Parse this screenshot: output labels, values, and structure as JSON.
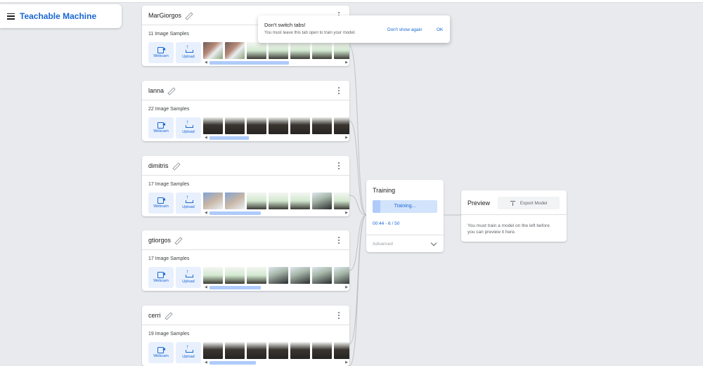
{
  "app": {
    "title": "Teachable Machine"
  },
  "classes": [
    {
      "name": "MarGiorgos",
      "samples": "11 Image Samples",
      "webcam_label": "Webcam",
      "upload_label": "Upload"
    },
    {
      "name": "lanna",
      "samples": "22 Image Samples",
      "webcam_label": "Webcam",
      "upload_label": "Upload"
    },
    {
      "name": "dimitris",
      "samples": "17 Image Samples",
      "webcam_label": "Webcam",
      "upload_label": "Upload"
    },
    {
      "name": "gtiorgos",
      "samples": "17 Image Samples",
      "webcam_label": "Webcam",
      "upload_label": "Upload"
    },
    {
      "name": "cerri",
      "samples": "19 Image Samples",
      "webcam_label": "Webcam",
      "upload_label": "Upload"
    }
  ],
  "training": {
    "title": "Training",
    "button_label": "Training...",
    "progress_fraction": 0.12,
    "time_text": "00:44 - 6 / 50",
    "advanced_label": "Advanced"
  },
  "preview": {
    "title": "Preview",
    "export_label": "Export Model",
    "message": "You must train a model on the left before you can preview it here."
  },
  "toast": {
    "title": "Don't switch tabs!",
    "text": "You must leave this tab open to train your model.",
    "dismiss_label": "Don't show again",
    "ok_label": "OK"
  },
  "colors": {
    "accent": "#1967d2",
    "button_bg": "#e8f0fe",
    "scroll_thumb": "#aecbfa",
    "page_bg": "#e8eaed"
  },
  "icons": [
    "menu-icon",
    "pencil-icon",
    "kebab-icon",
    "webcam-icon",
    "upload-icon",
    "chevron-down-icon",
    "export-icon"
  ]
}
